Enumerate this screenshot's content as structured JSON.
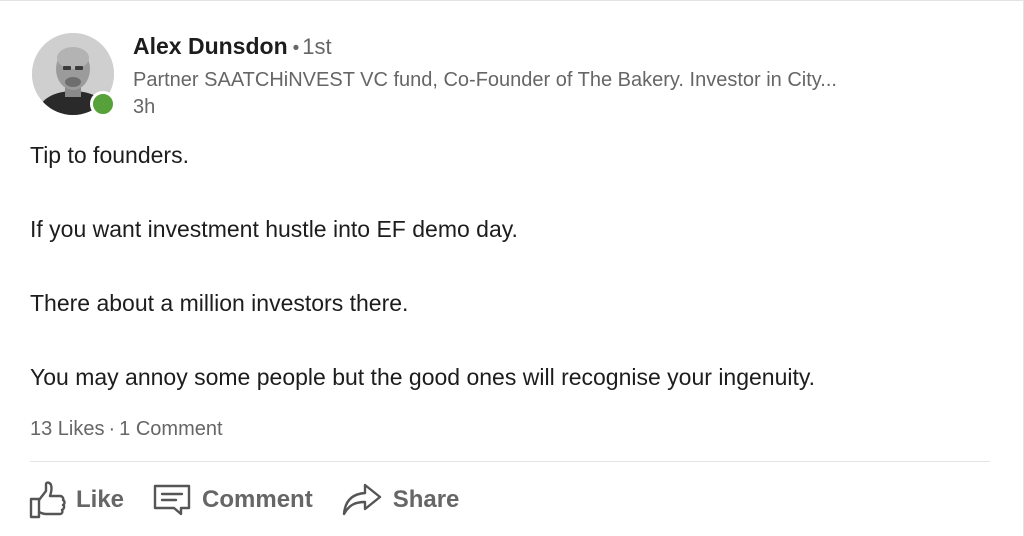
{
  "post": {
    "author": {
      "name": "Alex Dunsdon",
      "separator": "•",
      "degree": "1st",
      "headline": "Partner SAATCHiNVEST VC fund, Co-Founder of The Bakery. Investor in City...",
      "time": "3h",
      "presence_color": "#57a13a"
    },
    "paragraphs": [
      "Tip to founders.",
      "If you want investment hustle into EF demo day.",
      "There about a million investors there.",
      "You may annoy some people but the good ones will recognise your ingenuity."
    ],
    "counts": {
      "likes": "13 Likes",
      "separator": "·",
      "comments": "1 Comment"
    }
  },
  "actions": {
    "like": {
      "label": "Like",
      "icon": "thumbs-up-icon"
    },
    "comment": {
      "label": "Comment",
      "icon": "comment-icon"
    },
    "share": {
      "label": "Share",
      "icon": "share-arrow-icon"
    }
  }
}
